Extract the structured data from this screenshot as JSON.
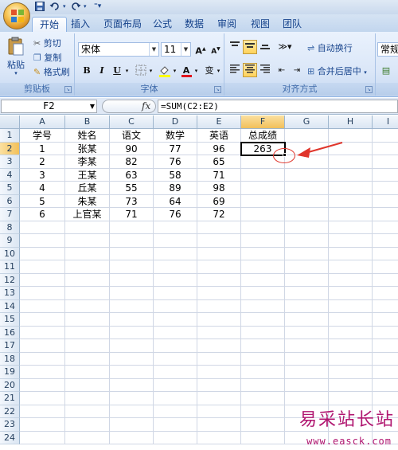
{
  "quick_access": {
    "save_icon": "save-icon",
    "undo_icon": "undo-icon",
    "redo_icon": "redo-icon",
    "customize_icon": "customize-icon"
  },
  "tabs": [
    {
      "label": "开始",
      "active": true
    },
    {
      "label": "插入"
    },
    {
      "label": "页面布局"
    },
    {
      "label": "公式"
    },
    {
      "label": "数据"
    },
    {
      "label": "审阅"
    },
    {
      "label": "视图"
    },
    {
      "label": "团队"
    }
  ],
  "ribbon": {
    "clipboard": {
      "paste": "粘贴",
      "cut": "剪切",
      "copy": "复制",
      "format_painter": "格式刷",
      "group_label": "剪贴板"
    },
    "font": {
      "name": "宋体",
      "size": "11",
      "grow": "A",
      "shrink": "A",
      "bold": "B",
      "italic": "I",
      "underline": "U",
      "font_color": "A",
      "phonetic": "变",
      "group_label": "字体"
    },
    "alignment": {
      "wrap_text": "自动换行",
      "merge_center": "合并后居中",
      "group_label": "对齐方式"
    },
    "number": {
      "format": "常规"
    }
  },
  "formula_bar": {
    "name_box": "F2",
    "fx": "fx",
    "formula": "=SUM(C2:E2)"
  },
  "sheet": {
    "columns": [
      "A",
      "B",
      "C",
      "D",
      "E",
      "F",
      "G",
      "H",
      "I"
    ],
    "row_numbers": [
      "1",
      "2",
      "3",
      "4",
      "5",
      "6",
      "7",
      "8",
      "9",
      "10",
      "11",
      "12",
      "13",
      "14",
      "15",
      "16",
      "17",
      "18",
      "19",
      "20",
      "21",
      "22",
      "23",
      "24"
    ],
    "header": [
      "学号",
      "姓名",
      "语文",
      "数学",
      "英语",
      "总成绩"
    ],
    "rows": [
      [
        "1",
        "张某",
        "90",
        "77",
        "96",
        "263"
      ],
      [
        "2",
        "李某",
        "82",
        "76",
        "65",
        ""
      ],
      [
        "3",
        "王某",
        "63",
        "58",
        "71",
        ""
      ],
      [
        "4",
        "丘某",
        "55",
        "89",
        "98",
        ""
      ],
      [
        "5",
        "朱某",
        "73",
        "64",
        "69",
        ""
      ],
      [
        "6",
        "上官某",
        "71",
        "76",
        "72",
        ""
      ]
    ],
    "selected_cell": "F2"
  },
  "annotation": {
    "color": "#e0352b"
  },
  "watermark": {
    "title": "易采站长站",
    "url": "www.easck.com",
    "color": "#b01670"
  }
}
